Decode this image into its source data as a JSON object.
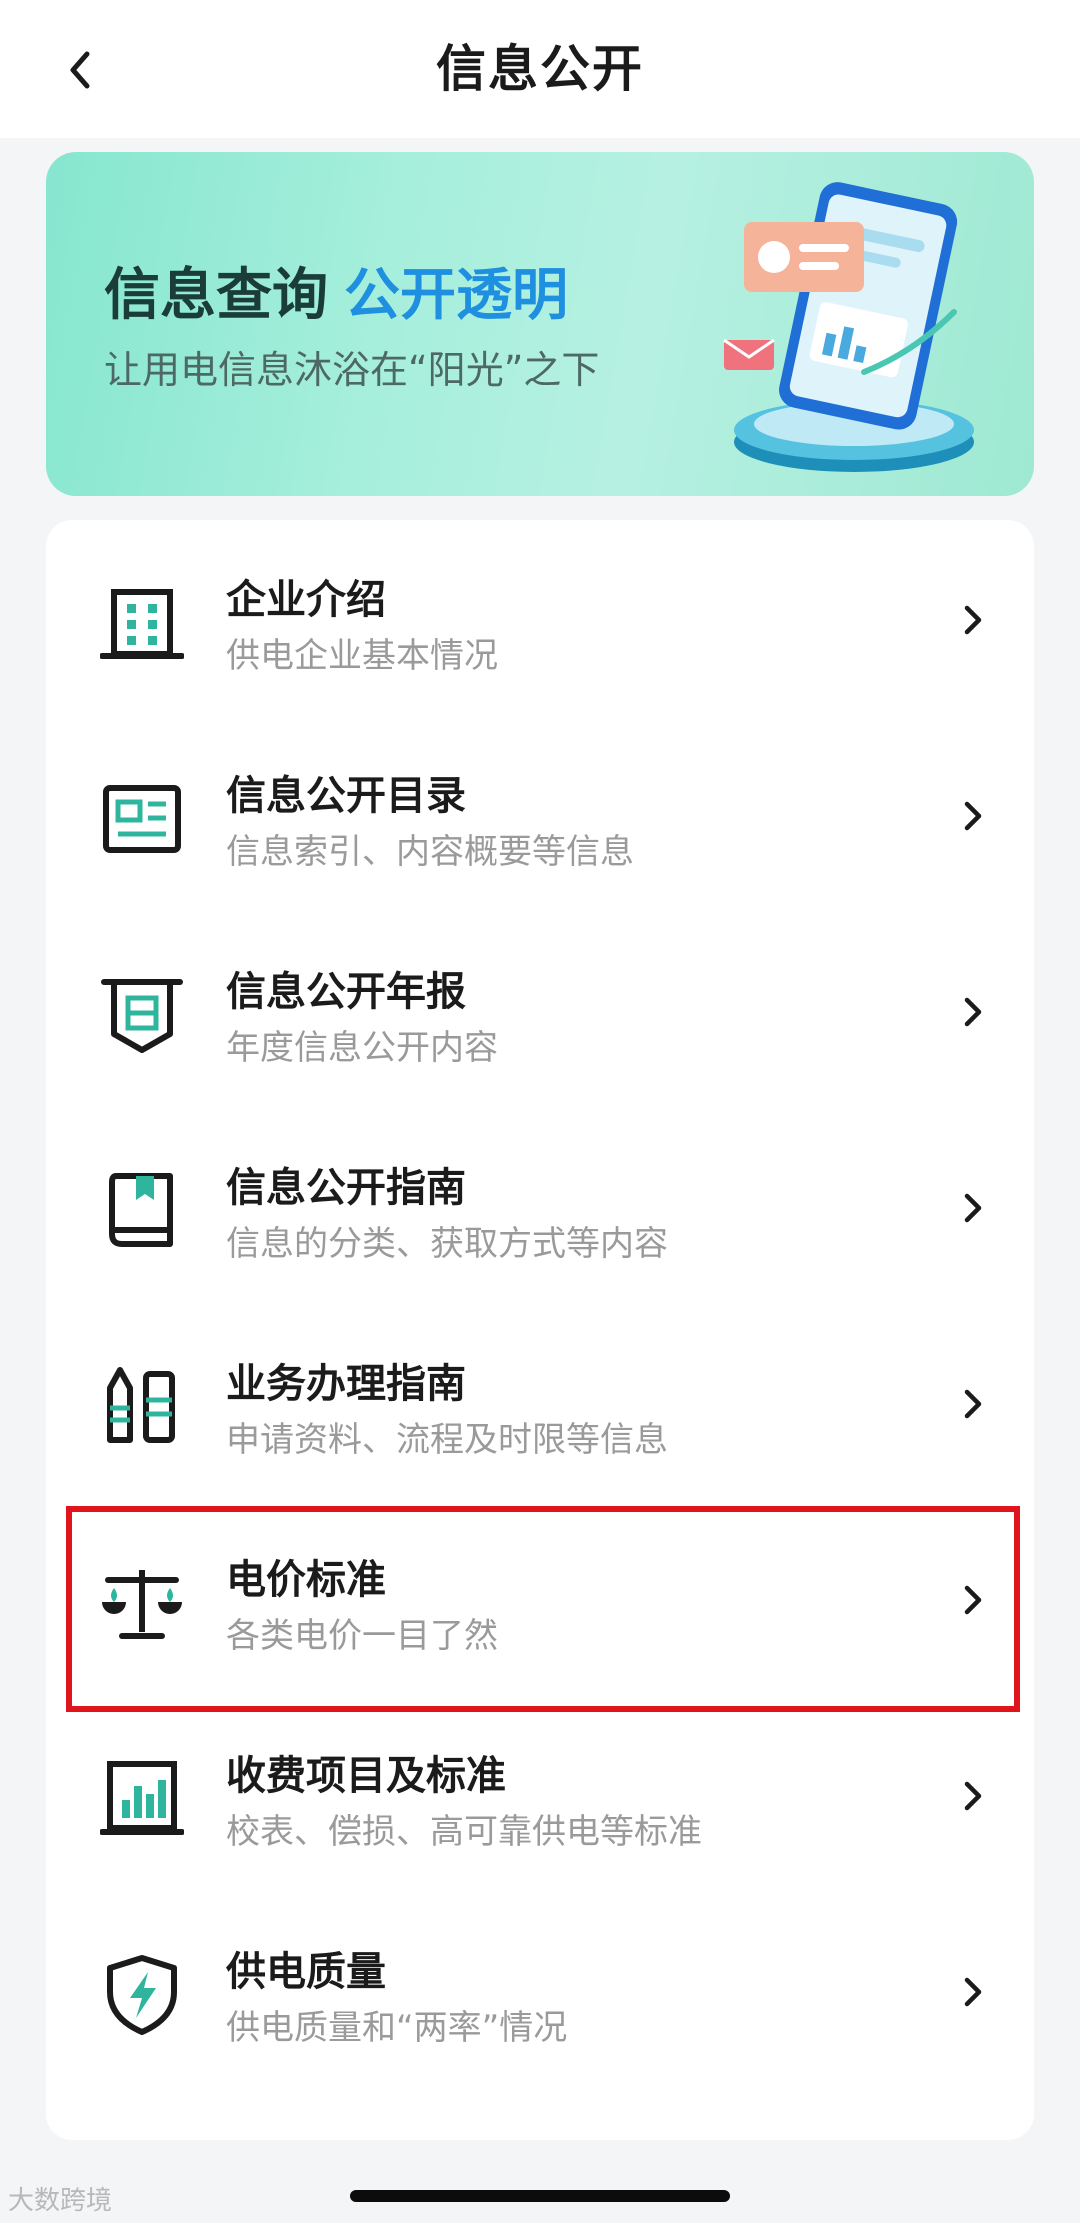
{
  "header": {
    "title": "信息公开",
    "back_icon": "chevron-left-icon"
  },
  "banner": {
    "title_part1": "信息查询",
    "title_part2": "公开透明",
    "subtitle": "让用电信息沐浴在“阳光”之下",
    "accent_color": "#1f8fe0",
    "illustration_icon": "phone-data-illustration"
  },
  "menu": {
    "items": [
      {
        "title": "企业介绍",
        "subtitle": "供电企业基本情况",
        "icon": "building-icon"
      },
      {
        "title": "信息公开目录",
        "subtitle": "信息索引、内容概要等信息",
        "icon": "newspaper-icon"
      },
      {
        "title": "信息公开年报",
        "subtitle": "年度信息公开内容",
        "icon": "shield-doc-icon"
      },
      {
        "title": "信息公开指南",
        "subtitle": "信息的分类、获取方式等内容",
        "icon": "book-icon"
      },
      {
        "title": "业务办理指南",
        "subtitle": "申请资料、流程及时限等信息",
        "icon": "tools-icon"
      },
      {
        "title": "电价标准",
        "subtitle": "各类电价一目了然",
        "icon": "scale-icon",
        "highlighted": true
      },
      {
        "title": "收费项目及标准",
        "subtitle": "校表、偿损、高可靠供电等标准",
        "icon": "bar-chart-icon"
      },
      {
        "title": "供电质量",
        "subtitle": "供电质量和“两率”情况",
        "icon": "lightning-shield-icon"
      }
    ]
  },
  "colors": {
    "icon_teal": "#2fb59d",
    "highlight": "#e0141c",
    "icon_dark": "#1b1b1b"
  },
  "watermark": "大数跨境"
}
